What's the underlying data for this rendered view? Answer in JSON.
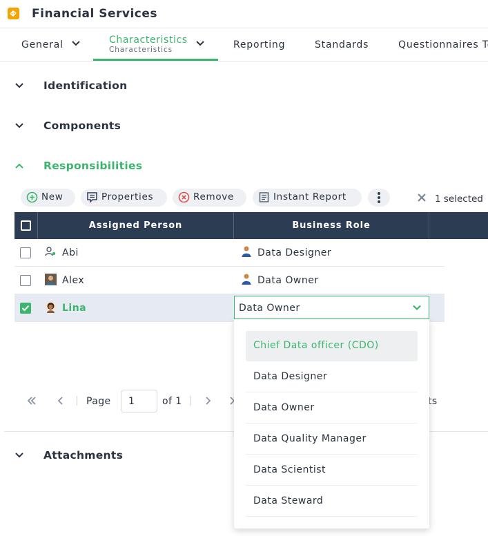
{
  "app": {
    "title": "Financial Services"
  },
  "tabs": [
    {
      "label": "General"
    },
    {
      "label": "Characteristics",
      "sublabel": "Characteristics"
    },
    {
      "label": "Reporting"
    },
    {
      "label": "Standards"
    },
    {
      "label": "Questionnaires Te"
    }
  ],
  "sections": {
    "identification": "Identification",
    "components": "Components",
    "responsibilities": "Responsibilities",
    "attachments": "Attachments"
  },
  "toolbar": {
    "new_label": "New",
    "properties_label": "Properties",
    "remove_label": "Remove",
    "instant_report_label": "Instant Report",
    "selection_text": "1 selected"
  },
  "table": {
    "columns": [
      "Assigned Person",
      "Business Role"
    ],
    "rows": [
      {
        "person": "Abi",
        "role": "Data Designer",
        "checked": false
      },
      {
        "person": "Alex",
        "role": "Data Owner",
        "checked": false
      },
      {
        "person": "Lina",
        "role": "Data Owner",
        "checked": true
      }
    ]
  },
  "role_select": {
    "value": "Data Owner"
  },
  "dropdown": {
    "options": [
      "Chief Data officer (CDO)",
      "Data Designer",
      "Data Owner",
      "Data Quality Manager",
      "Data Scientist",
      "Data Steward"
    ],
    "highlighted": "Chief Data officer (CDO)"
  },
  "pager": {
    "page_label": "Page",
    "page_value": "1",
    "of_label": "of 1",
    "trailing_text": "ts"
  },
  "colors": {
    "accent": "#3cb46e",
    "header_bg": "#2c3c52",
    "app_icon": "#f5a300",
    "remove_icon": "#d9534f"
  }
}
